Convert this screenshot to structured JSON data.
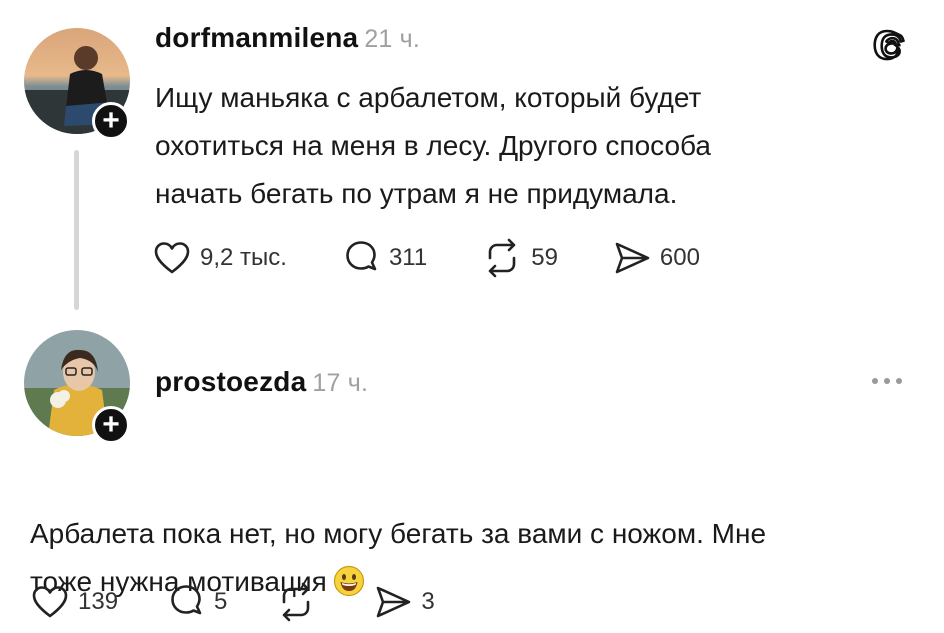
{
  "posts": [
    {
      "username": "dorfmanmilena",
      "time": "21 ч.",
      "text": "Ищу маньяка с арбалетом, который будет\nохотиться на меня в лесу. Другого способа\nначать бегать по утрам я не придумала.",
      "likes": "9,2 тыс.",
      "replies": "311",
      "reposts": "59",
      "shares": "600"
    },
    {
      "username": "prostoezda",
      "time": "17 ч.",
      "text": "Арбалета пока нет, но могу бегать за вами с ножом. Мне\nтоже нужна мотивация",
      "emoji": "grinning-face-emoji",
      "likes": "139",
      "replies": "5",
      "reposts": "",
      "shares": "3"
    }
  ],
  "icons": {
    "logo": "threads-logo-icon",
    "like": "heart-icon",
    "reply": "comment-icon",
    "repost": "repost-icon",
    "share": "send-icon",
    "follow": "plus-icon",
    "more": "more-dots-icon"
  },
  "colors": {
    "text": "#1a1a1a",
    "muted": "#a0a0a0",
    "thread_line": "#d6d6d6",
    "badge": "#111111"
  }
}
